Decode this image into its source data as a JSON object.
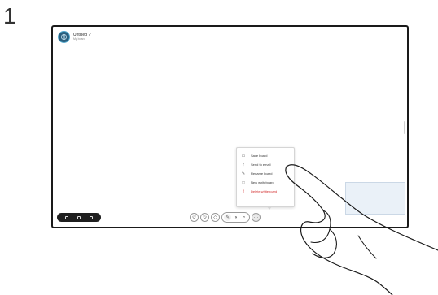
{
  "step": {
    "number": "1"
  },
  "board": {
    "title": "Untitled ✓",
    "subtitle": "My board"
  },
  "menu": {
    "items": [
      {
        "label": "Save board",
        "icon": "save-icon"
      },
      {
        "label": "Send to email",
        "icon": "upload-icon"
      },
      {
        "label": "Rename board",
        "icon": "pencil-icon"
      },
      {
        "label": "New whiteboard",
        "icon": "new-board-icon"
      },
      {
        "label": "Delete whiteboard",
        "icon": "trash-icon"
      }
    ]
  },
  "toolbar": {
    "tools": [
      "undo-icon",
      "redo-icon",
      "eraser-icon",
      "pen-icon",
      "shapes-icon",
      "sticky-note-icon",
      "more-icon"
    ]
  },
  "colors": {
    "danger": "#d22c2c",
    "avatar": "#2b5f7e"
  }
}
